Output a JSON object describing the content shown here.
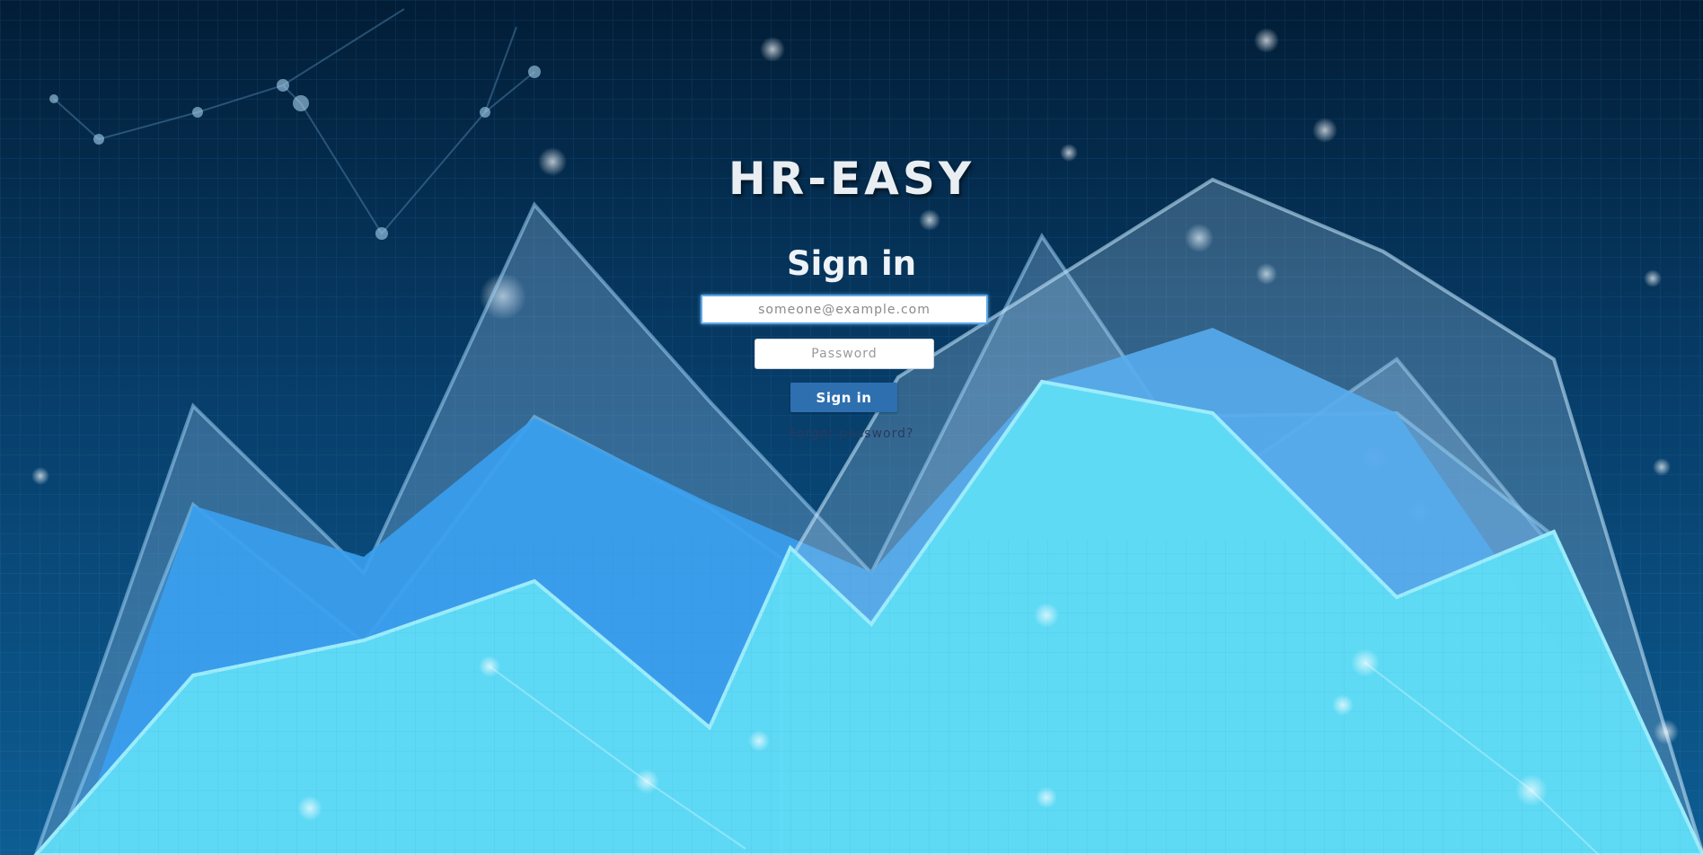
{
  "app": {
    "title": "HR-EASY"
  },
  "login": {
    "heading": "Sign in",
    "email_placeholder": "someone@example.com",
    "password_placeholder": "Password",
    "signin_button_label": "Sign in",
    "forgot_password_label": "Forgot password?"
  },
  "colors": {
    "background_dark": "#03243f",
    "mountain_light": "#5fdcf5",
    "mountain_mid": "#3aa0ef",
    "mountain_translucent": "#9cc4e8",
    "button_blue": "#2e6fb0",
    "title_text": "#e9eef3"
  }
}
